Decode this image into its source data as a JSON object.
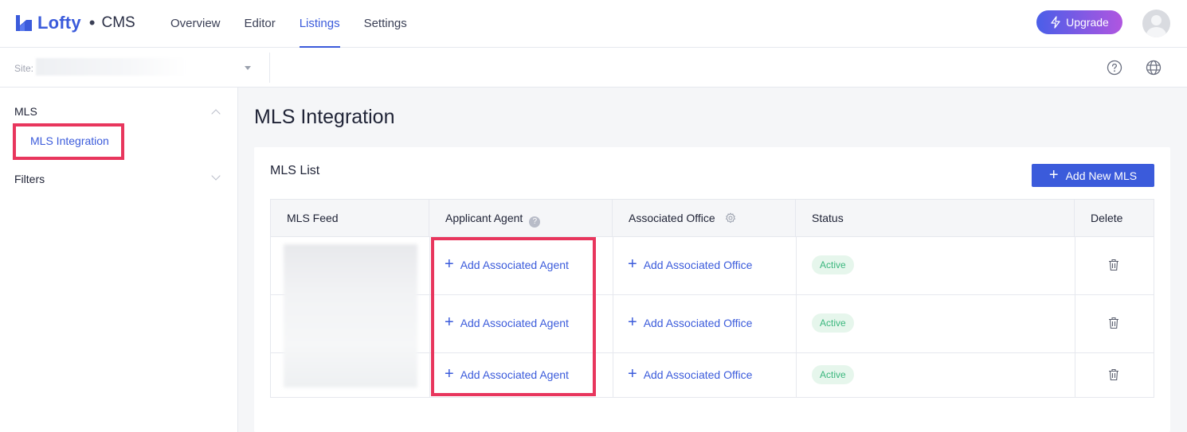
{
  "header": {
    "logo_text": "Lofty",
    "logo_dot": "•",
    "product": "CMS",
    "nav": [
      "Overview",
      "Editor",
      "Listings",
      "Settings"
    ],
    "active_nav": "Listings",
    "upgrade_label": "Upgrade"
  },
  "subbar": {
    "site_label": "Site:"
  },
  "sidebar": {
    "groups": [
      {
        "label": "MLS",
        "expanded": true,
        "items": [
          "MLS Integration"
        ]
      },
      {
        "label": "Filters",
        "expanded": false,
        "items": []
      }
    ]
  },
  "main": {
    "title": "MLS Integration",
    "card_title": "MLS List",
    "add_button": "Add New MLS",
    "columns": [
      "MLS Feed",
      "Applicant Agent",
      "Associated Office",
      "Status",
      "Delete"
    ],
    "rows": [
      {
        "agent_link": "Add Associated Agent",
        "office_link": "Add Associated Office",
        "status": "Active"
      },
      {
        "agent_link": "Add Associated Agent",
        "office_link": "Add Associated Office",
        "status": "Active"
      },
      {
        "agent_link": "Add Associated Agent",
        "office_link": "Add Associated Office",
        "status": "Active"
      }
    ]
  },
  "colors": {
    "accent": "#3b5bdb",
    "highlight": "#e8365d",
    "status_active_bg": "#e6f6ec",
    "status_active_text": "#3bb77e"
  },
  "icons": [
    "logo-icon",
    "lightning-icon",
    "avatar",
    "help-circle-icon",
    "globe-icon",
    "chevron-up-icon",
    "chevron-down-icon",
    "plus-icon",
    "question-icon",
    "gear-icon",
    "trash-icon"
  ]
}
